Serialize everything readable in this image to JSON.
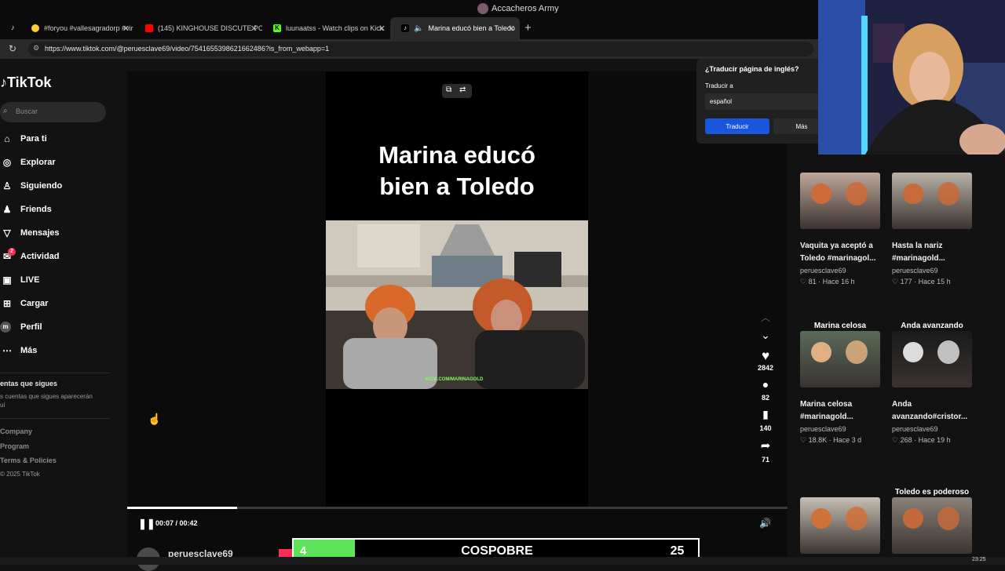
{
  "window": {
    "title": "Accacheros Army"
  },
  "tabs": [
    {
      "label": "#foryou #vallesagradorp #vir",
      "fav_color": "#ffcc33"
    },
    {
      "label": "(145) KINGHOUSE DISCUTE POR",
      "fav_color": "#ff0000"
    },
    {
      "label": "luunaatss - Watch clips on Kick",
      "fav_color": "#53fc18"
    },
    {
      "label": "Marina educó bien a Toledo",
      "fav_color": "#000000"
    }
  ],
  "address": {
    "url": "https://www.tiktok.com/@peruesclave69/video/7541655398621662486?is_from_webapp=1"
  },
  "sidebar": {
    "logo": "TikTok",
    "search_placeholder": "Buscar",
    "items": [
      {
        "label": "Para ti",
        "icon": "home-icon"
      },
      {
        "label": "Explorar",
        "icon": "compass-icon"
      },
      {
        "label": "Siguiendo",
        "icon": "following-icon"
      },
      {
        "label": "Friends",
        "icon": "friends-icon"
      },
      {
        "label": "Mensajes",
        "icon": "messages-icon"
      },
      {
        "label": "Actividad",
        "icon": "activity-icon",
        "badge": "2"
      },
      {
        "label": "LIVE",
        "icon": "live-icon"
      },
      {
        "label": "Cargar",
        "icon": "upload-icon"
      },
      {
        "label": "Perfil",
        "icon": "profile-icon"
      },
      {
        "label": "Más",
        "icon": "more-icon"
      }
    ],
    "following_title": "entas que sigues",
    "following_desc_1": "s cuentas que sigues aparecerán",
    "following_desc_2": "uí",
    "footer": [
      "Company",
      "Program",
      "Terms & Policies"
    ],
    "copyright": "© 2025 TikTok"
  },
  "video": {
    "title_line1": "Marina educó",
    "title_line2": "bien a Toledo",
    "watermark": "KICK.COM/MARINAGOLD",
    "time": "00:07 / 00:42",
    "progress": 0.1667,
    "author": "peruesclave69",
    "likes": "2842",
    "comments": "82",
    "saves": "140",
    "shares": "71"
  },
  "translate_popup": {
    "question": "¿Traducir página de inglés?",
    "label": "Traducir a",
    "language": "español",
    "translate_btn": "Traducir",
    "more_btn": "Más"
  },
  "related": [
    {
      "overlay": "",
      "caption": "Vaquita ya aceptó a Toledo #marinagol...",
      "user": "peruesclave69",
      "likes": "81",
      "age": "Hace 16 h"
    },
    {
      "overlay": "",
      "caption": "Hasta la nariz #marinagold...",
      "user": "peruesclave69",
      "likes": "177",
      "age": "Hace 15 h"
    },
    {
      "overlay": "Marina celosa",
      "caption": "Marina celosa #marinagold...",
      "user": "peruesclave69",
      "likes": "18.8K",
      "age": "Hace 3 d"
    },
    {
      "overlay": "Anda avanzando",
      "caption": "Anda avanzando#cristor...",
      "user": "peruesclave69",
      "likes": "268",
      "age": "Hace 19 h"
    },
    {
      "overlay": "",
      "caption": "",
      "user": "",
      "likes": "",
      "age": ""
    },
    {
      "overlay": "Toledo es poderoso",
      "caption": "",
      "user": "",
      "likes": "",
      "age": ""
    }
  ],
  "stream_overlay": {
    "left_score": "4",
    "name": "COSPOBRE",
    "right_score": "25"
  },
  "taskbar": {
    "clock": "23:25"
  },
  "colors": {
    "accent_blue": "#1a56db",
    "tiktok_red": "#fe2c55",
    "score_green": "#5de35a"
  }
}
